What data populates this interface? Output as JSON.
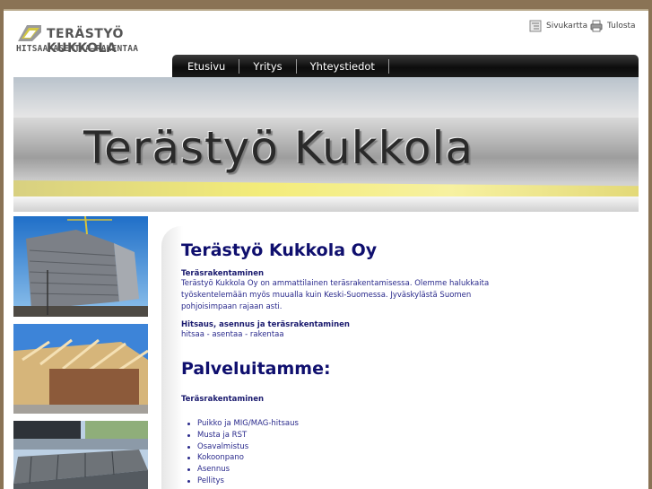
{
  "logo": {
    "name": "TERÄSTYÖ KUKKOLA",
    "tagline": "HITSAA–ASENTAA–RAKENTAA"
  },
  "utility": {
    "sitemap_label": "Sivukartta",
    "print_label": "Tulosta"
  },
  "nav": {
    "items": [
      {
        "label": "Etusivu"
      },
      {
        "label": "Yritys"
      },
      {
        "label": "Yhteystiedot"
      }
    ]
  },
  "banner": {
    "title": "Terästyö Kukkola"
  },
  "main": {
    "heading": "Terästyö Kukkola Oy",
    "intro_subtitle": "Teräsrakentaminen",
    "intro_text": "Terästyö Kukkola Oy on ammattilainen teräsrakentamisessa. Olemme halukkaita työskentelemään myös muualla kuin Keski-Suomessa. Jyväskylästä Suomen pohjoisimpaan rajaan asti.",
    "second_subtitle": "Hitsaus, asennus ja teräsrakentaminen",
    "second_text": "hitsaa - asentaa - rakentaa",
    "services_heading": "Palveluitamme:",
    "services_subtitle": "Teräsrakentaminen",
    "services": [
      "Puikko ja MIG/MAG-hitsaus",
      "Musta ja RST",
      "Osavalmistus",
      "Kokoonpano",
      "Asennus",
      "Pellitys"
    ]
  },
  "colors": {
    "heading": "#0f0f6e",
    "body_text": "#2a2a8c",
    "nav_bg": "#111111",
    "page_bg": "#8a7355"
  }
}
